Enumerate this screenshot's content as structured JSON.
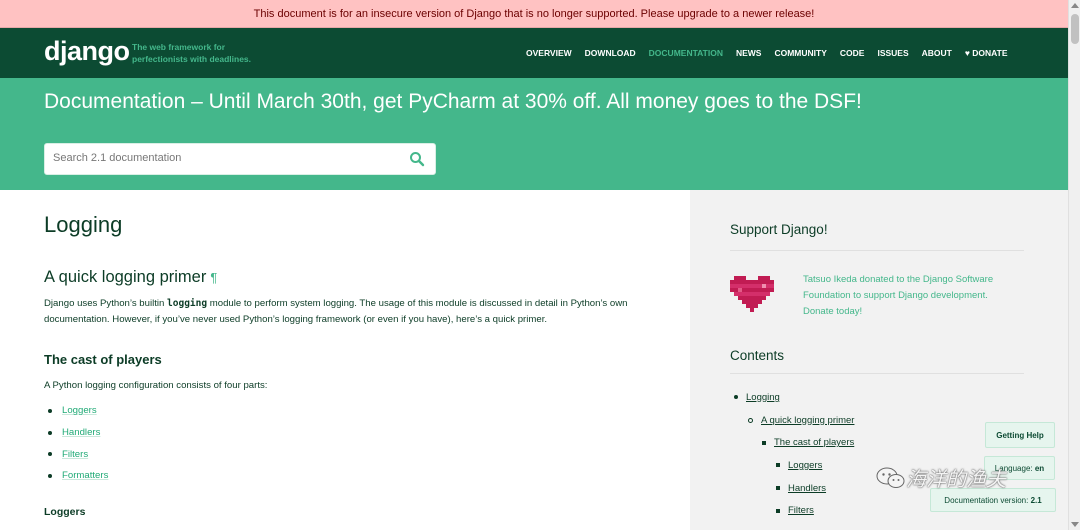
{
  "warning_bar": "This document is for an insecure version of Django that is no longer supported. Please upgrade to a newer release!",
  "header": {
    "logo": "django",
    "tagline": "The web framework for perfectionists with deadlines.",
    "nav": [
      "OVERVIEW",
      "DOWNLOAD",
      "DOCUMENTATION",
      "NEWS",
      "COMMUNITY",
      "CODE",
      "ISSUES",
      "ABOUT",
      "♥ DONATE"
    ],
    "active_nav": "DOCUMENTATION"
  },
  "banner": {
    "title": "Documentation – Until March 30th, get PyCharm at 30% off. All money goes to the DSF!",
    "search_placeholder": "Search 2.1 documentation",
    "search_icon": "search-icon"
  },
  "main": {
    "title": "Logging",
    "section_title": "A quick logging primer",
    "pilcrow": "¶",
    "intro_before": "Django uses Python’s builtin ",
    "intro_code": "logging",
    "intro_after": " module to perform system logging. The usage of this module is discussed in detail in Python’s own documentation. However, if you’ve never used Python’s logging framework (or even if you have), here’s a quick primer.",
    "cast_title": "The cast of players",
    "cast_intro": "A Python logging configuration consists of four parts:",
    "cast_items": [
      "Loggers",
      "Handlers",
      "Filters",
      "Formatters"
    ],
    "next_heading": "Loggers"
  },
  "sidebar": {
    "support_title": "Support Django!",
    "donor_text": "Tatsuo Ikeda donated to the Django Software Foundation to support Django development. Donate today!",
    "contents_title": "Contents",
    "toc": [
      "Logging",
      "A quick logging primer",
      "The cast of players",
      "Loggers",
      "Handlers",
      "Filters"
    ]
  },
  "floating": {
    "help": "Getting Help",
    "language_label": "Language:",
    "language_value": "en",
    "version_label": "Documentation version:",
    "version_value": "2.1"
  },
  "watermark": "海洋的渔夫",
  "colors": {
    "dark_green": "#0c4b33",
    "brand_green": "#44b78b",
    "warning_bg": "#ffc2c2"
  }
}
